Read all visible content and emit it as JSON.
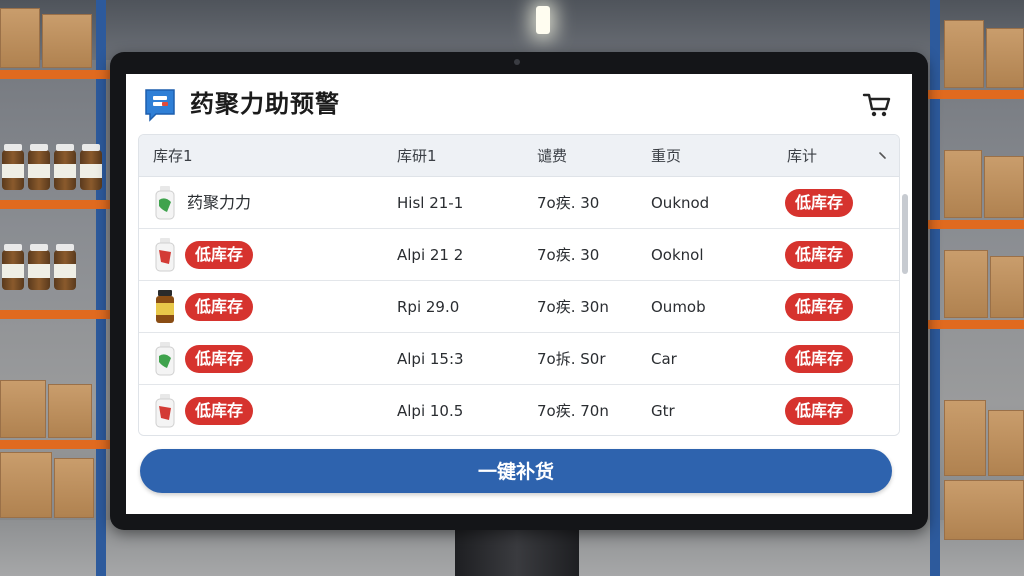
{
  "app": {
    "title": "药聚力助预警",
    "logo_icon": "app-logo-icon",
    "cart_icon": "cart-icon"
  },
  "colors": {
    "accent": "#2e63ae",
    "alert": "#d6332e",
    "header_bg": "#eef1f5"
  },
  "table": {
    "headers": [
      "库存1",
      "库研1",
      "谴费",
      "重页",
      "库计"
    ],
    "rows": [
      {
        "name": "药聚力力",
        "name_is_badge": false,
        "bottle": "green-bottle-icon",
        "c2": "Hisl 21-1",
        "c3": "7o疾. 30",
        "c4": "Ouknod",
        "stock": "低库存"
      },
      {
        "name": "低库存",
        "name_is_badge": true,
        "bottle": "red-bottle-icon",
        "c2": "Alpi 21 2",
        "c3": "7o疾. 30",
        "c4": "Ooknol",
        "stock": "低库存"
      },
      {
        "name": "低库存",
        "name_is_badge": true,
        "bottle": "amber-jar-icon",
        "c2": "Rpi 29.0",
        "c3": "7o疾. 30n",
        "c4": "Oumob",
        "stock": "低库存"
      },
      {
        "name": "低库存",
        "name_is_badge": true,
        "bottle": "green-bottle-icon",
        "c2": "Alpi 15:3",
        "c3": "7o拆. S0r",
        "c4": "Car",
        "stock": "低库存"
      },
      {
        "name": "低库存",
        "name_is_badge": true,
        "bottle": "red-bottle-icon",
        "c2": "Alpi 10.5",
        "c3": "7o疾. 70n",
        "c4": "Gtr",
        "stock": "低库存"
      }
    ]
  },
  "actions": {
    "restock_label": "一键补货"
  }
}
